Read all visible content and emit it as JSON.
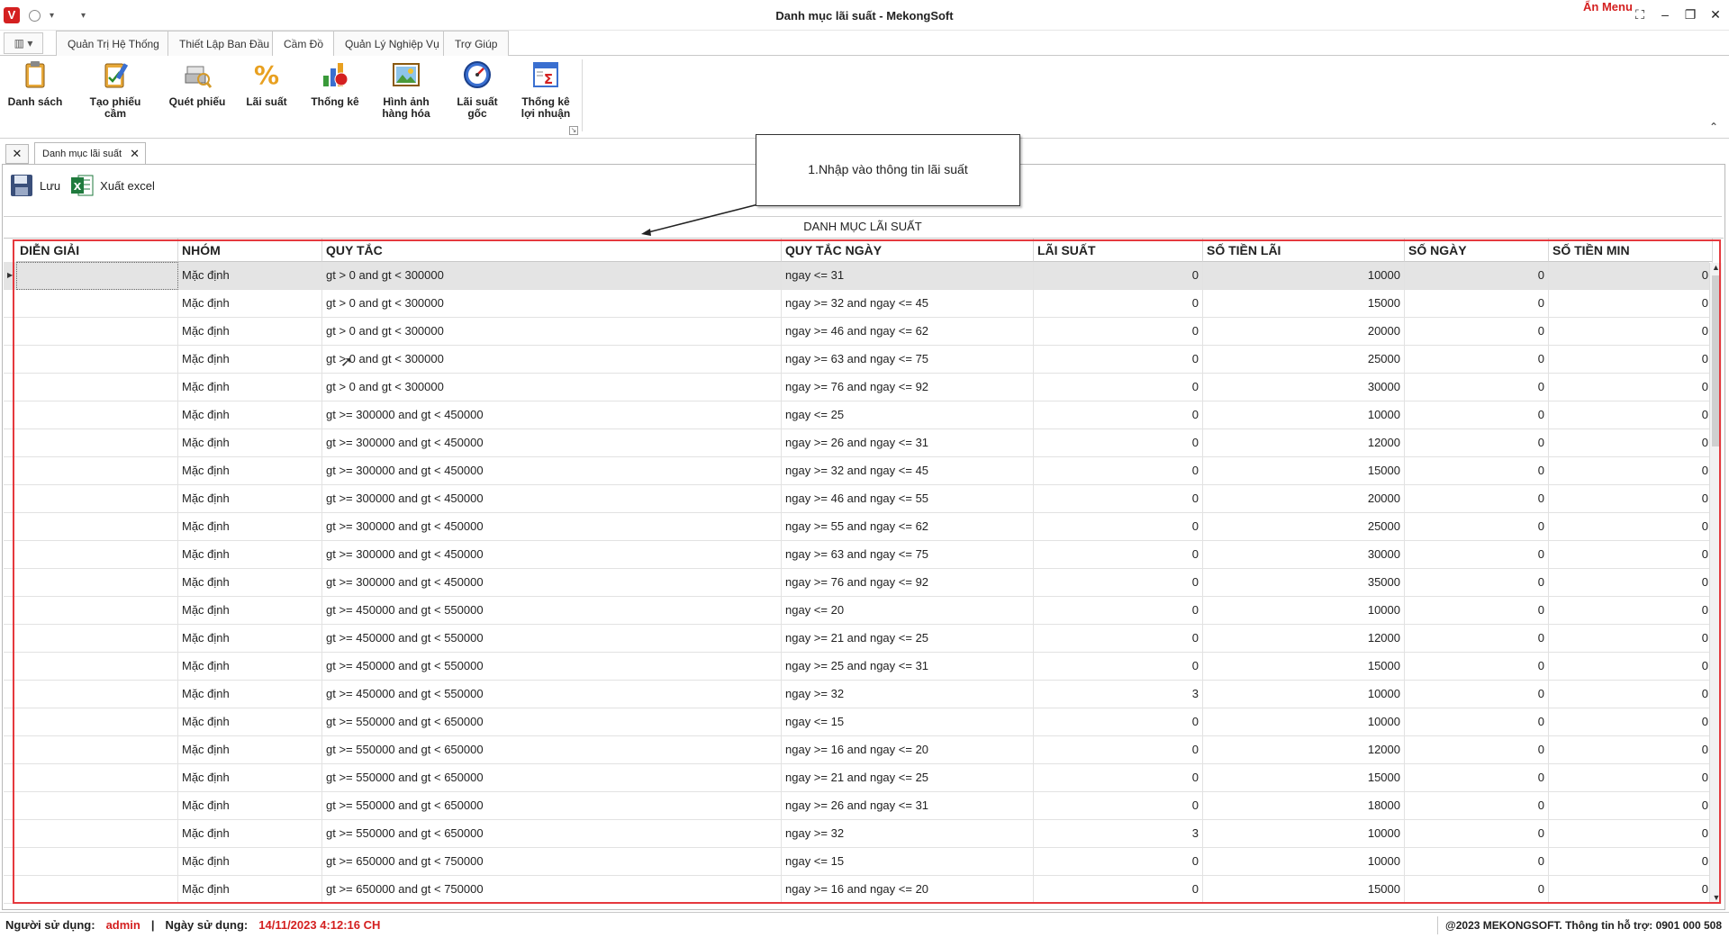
{
  "window": {
    "title": "Danh mục lãi suất - MekongSoft",
    "hide_menu_label": "Ẩn Menu",
    "logo_letter": "V"
  },
  "ribbon_tabs": [
    {
      "label": "Quản Trị Hệ Thống"
    },
    {
      "label": "Thiết Lập Ban Đầu"
    },
    {
      "label": "Cầm Đồ",
      "active": true
    },
    {
      "label": "Quản Lý Nghiệp Vụ"
    },
    {
      "label": "Trợ Giúp"
    }
  ],
  "ribbon_buttons": [
    {
      "line1": "Danh sách",
      "line2": "",
      "icon": "clipboard-icon"
    },
    {
      "line1": "Tạo phiếu cầm",
      "line2": "",
      "icon": "pencil-clipboard-icon"
    },
    {
      "line1": "Quét phiếu",
      "line2": "",
      "icon": "scanner-icon"
    },
    {
      "line1": "Lãi suất",
      "line2": "",
      "icon": "percent-icon"
    },
    {
      "line1": "Thống kê",
      "line2": "",
      "icon": "chart-icon"
    },
    {
      "line1": "Hình ảnh",
      "line2": "hàng hóa",
      "icon": "image-icon"
    },
    {
      "line1": "Lãi suất",
      "line2": "gốc",
      "icon": "gauge-icon"
    },
    {
      "line1": "Thống kê",
      "line2": "lợi nhuận",
      "icon": "sum-report-icon"
    }
  ],
  "doc_tab": {
    "label": "Danh mục lãi suất"
  },
  "toolbar": {
    "save_label": "Lưu",
    "excel_label": "Xuất excel"
  },
  "callout": {
    "text": "1.Nhập vào thông tin lãi suất"
  },
  "grid": {
    "title": "DANH MỤC LÃI SUẤT",
    "columns": [
      "DIỄN GIẢI",
      "NHÓM",
      "QUY TẮC",
      "QUY TẮC NGÀY",
      "LÃI SUẤT",
      "SỐ TIỀN LÃI",
      "SỐ NGÀY",
      "SỐ TIỀN MIN"
    ],
    "rows": [
      [
        "",
        "Mặc định",
        "gt > 0 and gt < 300000",
        "ngay <= 31",
        "0",
        "10000",
        "0",
        "0"
      ],
      [
        "",
        "Mặc định",
        "gt > 0 and gt < 300000",
        "ngay >= 32 and ngay <= 45",
        "0",
        "15000",
        "0",
        "0"
      ],
      [
        "",
        "Mặc định",
        "gt > 0 and gt < 300000",
        "ngay >= 46 and ngay <= 62",
        "0",
        "20000",
        "0",
        "0"
      ],
      [
        "",
        "Mặc định",
        "gt > 0 and gt < 300000",
        "ngay >= 63 and ngay <= 75",
        "0",
        "25000",
        "0",
        "0"
      ],
      [
        "",
        "Mặc định",
        "gt > 0 and gt < 300000",
        "ngay >= 76 and ngay <= 92",
        "0",
        "30000",
        "0",
        "0"
      ],
      [
        "",
        "Mặc định",
        "gt >= 300000 and gt < 450000",
        "ngay <= 25",
        "0",
        "10000",
        "0",
        "0"
      ],
      [
        "",
        "Mặc định",
        "gt >= 300000 and gt < 450000",
        "ngay >= 26 and ngay <= 31",
        "0",
        "12000",
        "0",
        "0"
      ],
      [
        "",
        "Mặc định",
        "gt >= 300000 and gt < 450000",
        "ngay >= 32 and ngay <= 45",
        "0",
        "15000",
        "0",
        "0"
      ],
      [
        "",
        "Mặc định",
        "gt >= 300000 and gt < 450000",
        "ngay >= 46 and ngay <= 55",
        "0",
        "20000",
        "0",
        "0"
      ],
      [
        "",
        "Mặc định",
        "gt >= 300000 and gt < 450000",
        "ngay >= 55 and ngay <= 62",
        "0",
        "25000",
        "0",
        "0"
      ],
      [
        "",
        "Mặc định",
        "gt >= 300000 and gt < 450000",
        "ngay >= 63 and ngay <= 75",
        "0",
        "30000",
        "0",
        "0"
      ],
      [
        "",
        "Mặc định",
        "gt >= 300000 and gt < 450000",
        "ngay >= 76 and ngay <= 92",
        "0",
        "35000",
        "0",
        "0"
      ],
      [
        "",
        "Mặc định",
        "gt >= 450000 and gt < 550000",
        "ngay <= 20",
        "0",
        "10000",
        "0",
        "0"
      ],
      [
        "",
        "Mặc định",
        "gt >= 450000 and gt < 550000",
        "ngay >= 21 and ngay <= 25",
        "0",
        "12000",
        "0",
        "0"
      ],
      [
        "",
        "Mặc định",
        "gt >= 450000 and gt < 550000",
        "ngay >= 25 and ngay <= 31",
        "0",
        "15000",
        "0",
        "0"
      ],
      [
        "",
        "Mặc định",
        "gt >= 450000 and gt < 550000",
        "ngay >= 32",
        "3",
        "10000",
        "0",
        "0"
      ],
      [
        "",
        "Mặc định",
        "gt >= 550000 and gt < 650000",
        "ngay <= 15",
        "0",
        "10000",
        "0",
        "0"
      ],
      [
        "",
        "Mặc định",
        "gt >= 550000 and gt < 650000",
        "ngay >= 16 and ngay <= 20",
        "0",
        "12000",
        "0",
        "0"
      ],
      [
        "",
        "Mặc định",
        "gt >= 550000 and gt < 650000",
        "ngay >= 21 and ngay <= 25",
        "0",
        "15000",
        "0",
        "0"
      ],
      [
        "",
        "Mặc định",
        "gt >= 550000 and gt < 650000",
        "ngay >= 26 and ngay <= 31",
        "0",
        "18000",
        "0",
        "0"
      ],
      [
        "",
        "Mặc định",
        "gt >= 550000 and gt < 650000",
        "ngay >= 32",
        "3",
        "10000",
        "0",
        "0"
      ],
      [
        "",
        "Mặc định",
        "gt >= 650000 and gt < 750000",
        "ngay <= 15",
        "0",
        "10000",
        "0",
        "0"
      ],
      [
        "",
        "Mặc định",
        "gt >= 650000 and gt < 750000",
        "ngay >= 16 and ngay <= 20",
        "0",
        "15000",
        "0",
        "0"
      ]
    ]
  },
  "status": {
    "user_label": "Người sử dụng:",
    "user_value": "admin",
    "separator": "|",
    "date_label": "Ngày sử dụng:",
    "date_value": "14/11/2023 4:12:16 CH",
    "copyright": "@2023 MEKONGSOFT. Thông tin hỗ trợ: 0901 000 508"
  },
  "colors": {
    "accent_red": "#e5393e",
    "brand_red": "#d42020"
  }
}
